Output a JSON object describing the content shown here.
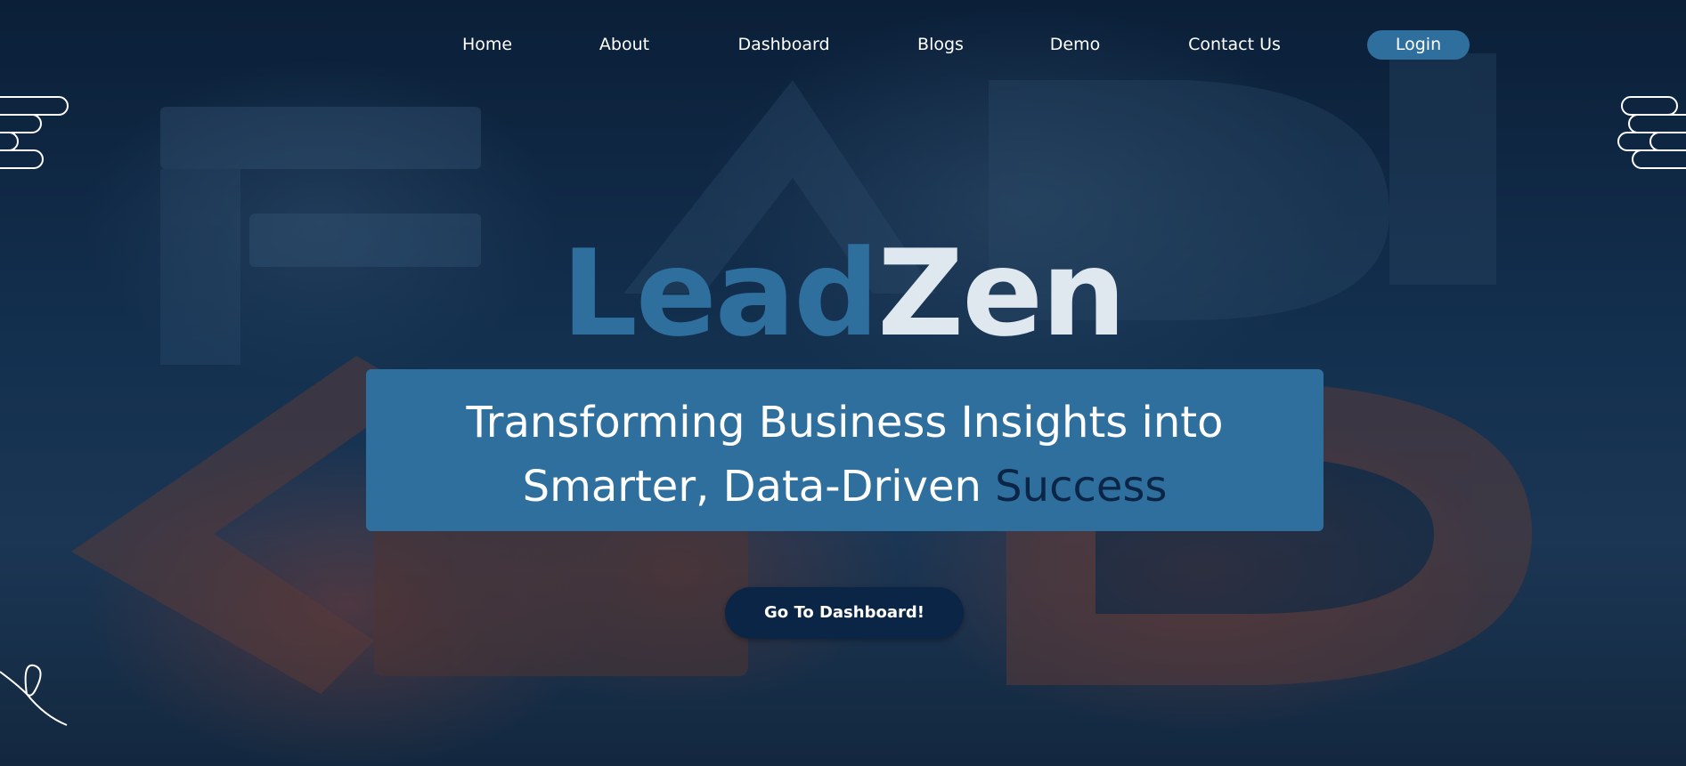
{
  "nav": {
    "items": [
      {
        "label": "Home"
      },
      {
        "label": "About"
      },
      {
        "label": "Dashboard"
      },
      {
        "label": "Blogs"
      },
      {
        "label": "Demo"
      },
      {
        "label": "Contact Us"
      }
    ],
    "login_label": "Login"
  },
  "hero": {
    "brand_part1": "Lead",
    "brand_part2": "Zen",
    "tagline_line1": "Transforming Business Insights into",
    "tagline_line2_prefix": "Smarter, Data-Driven ",
    "tagline_line2_accent": "Success",
    "cta_label": "Go To Dashboard!"
  },
  "colors": {
    "brand_blue": "#2e6f9e",
    "navy": "#0b2546",
    "brand_light": "#dfe7ef",
    "background": "#0e2440"
  },
  "decorations": {
    "left_top": "stacked-rounded-lines-icon",
    "right_top": "stacked-rounded-lines-icon",
    "left_bottom": "squiggle-loop-icon",
    "background": "3d-letter-blocks-image"
  }
}
